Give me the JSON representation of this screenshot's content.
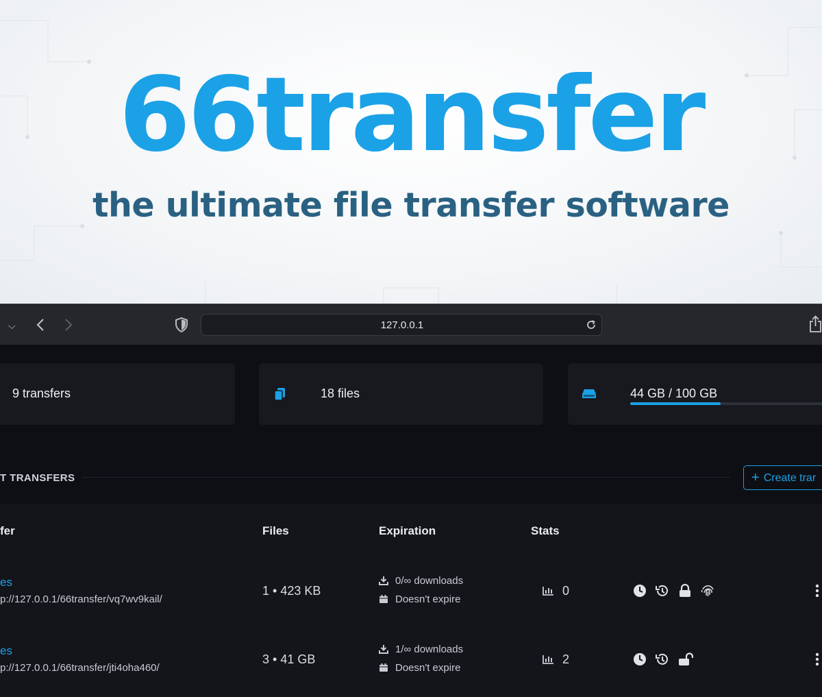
{
  "hero": {
    "title": "66transfer",
    "subtitle": "the ultimate file transfer software",
    "title_color": "#1ba1e6",
    "subtitle_color": "#2a6182"
  },
  "browser": {
    "url": "127.0.0.1",
    "icons": [
      "chevron-down-icon",
      "back-arrow-icon",
      "forward-arrow-icon",
      "shield-icon",
      "reload-icon",
      "share-icon"
    ]
  },
  "stats": {
    "transfers": "9 transfers",
    "files": "18 files",
    "storage": "44 GB / 100 GB",
    "storage_fraction": 0.44
  },
  "section": {
    "title": "T TRANSFERS",
    "create_label": "Create trar"
  },
  "table": {
    "headers": [
      "fer",
      "Files",
      "Expiration",
      "Stats"
    ],
    "rows": [
      {
        "name": "es",
        "url": "p://127.0.0.1/66transfer/vq7wv9kail/",
        "files": "1 • 423 KB",
        "downloads": "0/∞ downloads",
        "expiry": "Doesn't expire",
        "stats": "0",
        "lock": "locked",
        "icons": [
          "clock-icon",
          "history-icon",
          "lock-icon",
          "fingerprint-icon",
          "kebab-menu-icon"
        ]
      },
      {
        "name": "es",
        "url": "p://127.0.0.1/66transfer/jti4oha460/",
        "files": "3 • 41 GB",
        "downloads": "1/∞ downloads",
        "expiry": "Doesn't expire",
        "stats": "2",
        "lock": "unlocked",
        "icons": [
          "clock-icon",
          "history-icon",
          "unlock-icon",
          "kebab-menu-icon"
        ]
      }
    ]
  },
  "colors": {
    "accent": "#1ba1e6",
    "page_bg": "#0d0f14",
    "card_bg": "#17191f",
    "table_bg": "#13151b"
  }
}
